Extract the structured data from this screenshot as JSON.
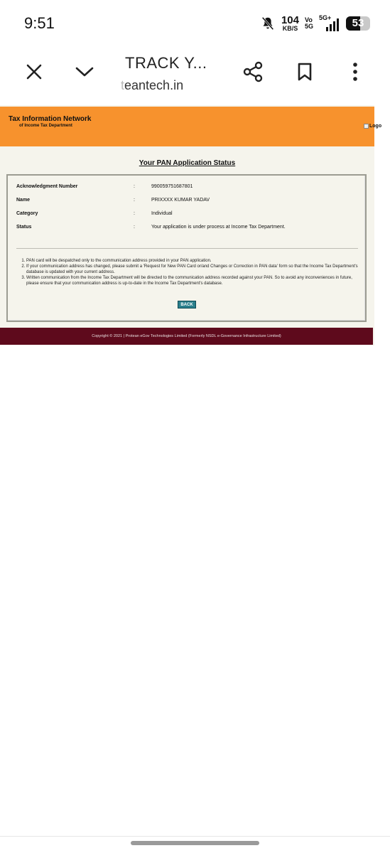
{
  "status_bar": {
    "time": "9:51",
    "net_speed_value": "104",
    "net_speed_unit": "KB/S",
    "volte_top": "Vo",
    "volte_bottom": "5G",
    "signal_label": "5G+",
    "battery_level": "53"
  },
  "browser": {
    "tab_title": "TRACK Y...",
    "url_faded": "t",
    "url_main": "eantech.in"
  },
  "site": {
    "brand_title": "Tax Information Network",
    "brand_subtitle": "of Income Tax Department",
    "logo_alt": "Logo",
    "heading": "Your PAN Application Status",
    "fields": [
      {
        "label": "Acknowledgment Number",
        "separator": ":",
        "value": "990059751687801"
      },
      {
        "label": "Name",
        "separator": ":",
        "value": "PRIXXXX KUMAR YADAV"
      },
      {
        "label": "Category",
        "separator": ":",
        "value": "Individual"
      },
      {
        "label": "Status",
        "separator": ":",
        "value": "Your application is under process at Income Tax Department."
      }
    ],
    "notes": [
      "PAN card will be despatched only to the communication address provided in your PAN application.",
      "If your communication address has changed, please submit a 'Request for New PAN Card or/and Changes or Correction in PAN data' form so that the Income Tax Department's database is updated with your current address.",
      "Written communication from the Income Tax Department will be directed to the communication address recorded against your PAN. So to avoid any inconveniences in future, please ensure that your communication address is up-to-date in the Income Tax Department's database."
    ],
    "back_label": "BACK",
    "footer": "Copyright © 2021 | Protean eGov Technologies Limited (Formerly NSDL e-Governance Infrastructure Limited)"
  },
  "colors": {
    "header_orange": "#f7922d",
    "footer_maroon": "#5e0a1c",
    "back_button": "#2a7f8c",
    "page_bg": "#f5f4ec"
  },
  "icons": [
    "bell-muted-icon",
    "close-icon",
    "chevron-down-icon",
    "share-icon",
    "bookmark-icon",
    "more-vert-icon"
  ]
}
